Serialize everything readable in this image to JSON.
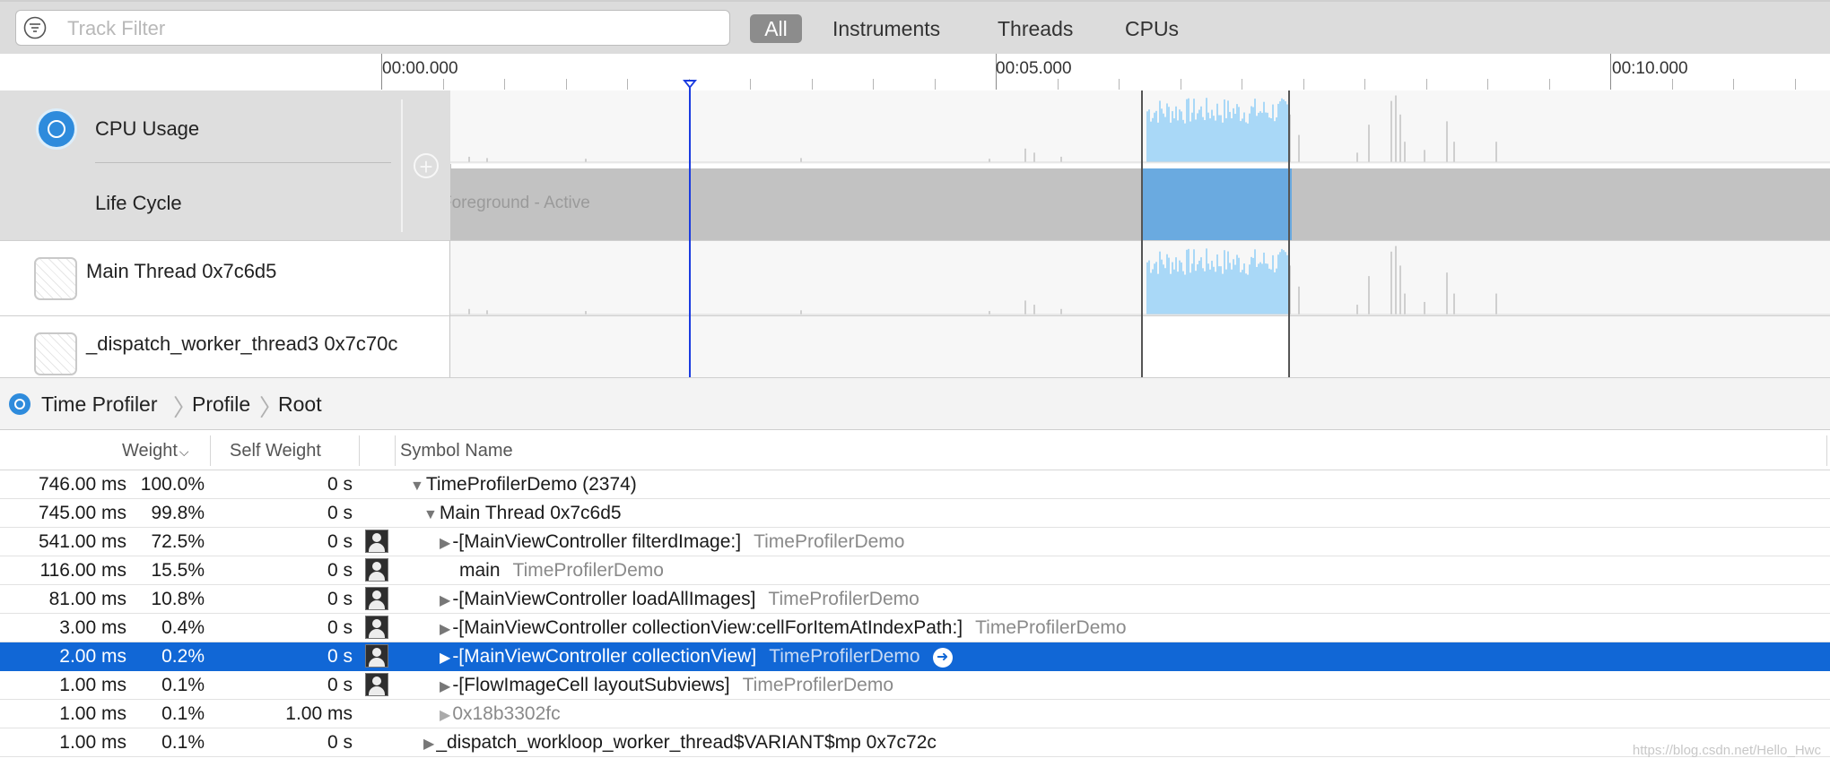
{
  "filter": {
    "placeholder": "Track Filter"
  },
  "segments": {
    "all": "All",
    "instruments": "Instruments",
    "threads": "Threads",
    "cpus": "CPUs"
  },
  "ruler": {
    "labels": [
      "00:00.000",
      "00:05.000",
      "00:10.000"
    ]
  },
  "tracks": {
    "cpu_usage": "CPU Usage",
    "life_cycle": "Life Cycle",
    "life_cycle_state": "Foreground - Active",
    "main_thread": "Main Thread  0x7c6d5",
    "worker_thread": "_dispatch_worker_thread3  0x7c70c"
  },
  "breadcrumb": [
    "Time Profiler",
    "Profile",
    "Root"
  ],
  "tree": {
    "headers": {
      "weight": "Weight",
      "self_weight": "Self Weight",
      "symbol": "Symbol Name"
    },
    "rows": [
      {
        "ms": "746.00 ms",
        "pct": "100.0%",
        "self": "0 s",
        "disclosure": "open",
        "symbol": "TimeProfilerDemo (2374)",
        "library": "",
        "user": false
      },
      {
        "ms": "745.00 ms",
        "pct": "99.8%",
        "self": "0 s",
        "disclosure": "open",
        "symbol": "Main Thread  0x7c6d5",
        "library": "",
        "user": false
      },
      {
        "ms": "541.00 ms",
        "pct": "72.5%",
        "self": "0 s",
        "disclosure": "closed",
        "symbol": "-[MainViewController filterdImage:]",
        "library": "TimeProfilerDemo",
        "user": true
      },
      {
        "ms": "116.00 ms",
        "pct": "15.5%",
        "self": "0 s",
        "disclosure": "none",
        "symbol": "main",
        "library": "TimeProfilerDemo",
        "user": true
      },
      {
        "ms": "81.00 ms",
        "pct": "10.8%",
        "self": "0 s",
        "disclosure": "closed",
        "symbol": "-[MainViewController loadAllImages]",
        "library": "TimeProfilerDemo",
        "user": true
      },
      {
        "ms": "3.00 ms",
        "pct": "0.4%",
        "self": "0 s",
        "disclosure": "closed",
        "symbol": "-[MainViewController collectionView:cellForItemAtIndexPath:]",
        "library": "TimeProfilerDemo",
        "user": true
      },
      {
        "ms": "2.00 ms",
        "pct": "0.2%",
        "self": "0 s",
        "disclosure": "closed",
        "symbol": "-[MainViewController collectionView]",
        "library": "TimeProfilerDemo",
        "user": true,
        "selected": true
      },
      {
        "ms": "1.00 ms",
        "pct": "0.1%",
        "self": "0 s",
        "disclosure": "closed",
        "symbol": "-[FlowImageCell layoutSubviews]",
        "library": "TimeProfilerDemo",
        "user": true
      },
      {
        "ms": "1.00 ms",
        "pct": "0.1%",
        "self": "1.00 ms",
        "disclosure": "closed-gray",
        "symbol": "0x18b3302fc",
        "library": "",
        "user": false
      },
      {
        "ms": "1.00 ms",
        "pct": "0.1%",
        "self": "0 s",
        "disclosure": "closed",
        "symbol": "_dispatch_workloop_worker_thread$VARIANT$mp  0x7c72c",
        "library": "",
        "user": false
      }
    ]
  },
  "watermark": "https://blog.csdn.net/Hello_Hwc",
  "colors": {
    "accent": "#1167d6",
    "cpu_fill": "#a9d8f7",
    "lifecycle_active": "#6aaae0",
    "playhead": "#1a3be0"
  },
  "icons": {
    "filter": "filter-icon",
    "cpu": "cpu-gauge-icon",
    "thread": "thread-icon",
    "user_code": "user-code-icon",
    "go": "go-arrow-icon",
    "add": "add-track-icon"
  }
}
